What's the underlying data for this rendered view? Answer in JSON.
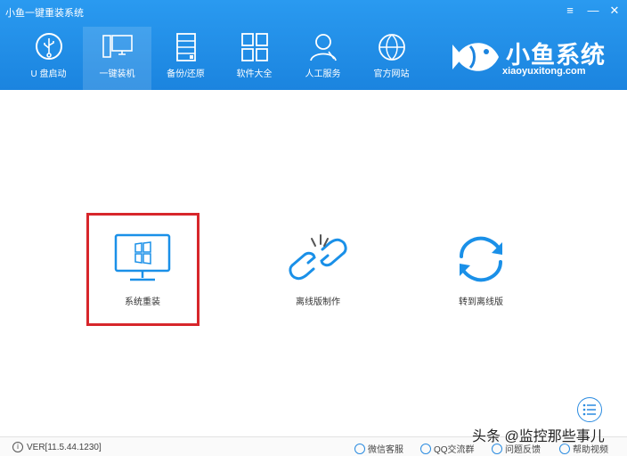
{
  "window": {
    "title": "小鱼一键重装系统",
    "menu_glyph": "≡",
    "minimize_glyph": "—",
    "close_glyph": "✕"
  },
  "nav": [
    {
      "label": "U 盘启动",
      "icon": "usb-icon"
    },
    {
      "label": "一键装机",
      "icon": "computer-icon",
      "active": true
    },
    {
      "label": "备份/还原",
      "icon": "cabinet-icon"
    },
    {
      "label": "软件大全",
      "icon": "apps-grid-icon"
    },
    {
      "label": "人工服务",
      "icon": "support-person-icon"
    },
    {
      "label": "官方网站",
      "icon": "globe-icon"
    }
  ],
  "logo": {
    "name": "小鱼系统",
    "url_text": "xiaoyuxitong.com"
  },
  "options": [
    {
      "label": "系统重装",
      "icon": "windows-monitor-icon",
      "selected": true
    },
    {
      "label": "离线版制作",
      "icon": "broken-link-icon"
    },
    {
      "label": "转到离线版",
      "icon": "refresh-arrows-icon"
    }
  ],
  "statusbar": {
    "version": "VER[11.5.44.1230]",
    "links": [
      "微信客服",
      "QQ交流群",
      "问题反馈",
      "帮助视频"
    ]
  },
  "watermark": "头条 @监控那些事儿",
  "colors": {
    "header": "#1b84df",
    "accent": "#2a8be0",
    "selection": "#d7262b"
  }
}
